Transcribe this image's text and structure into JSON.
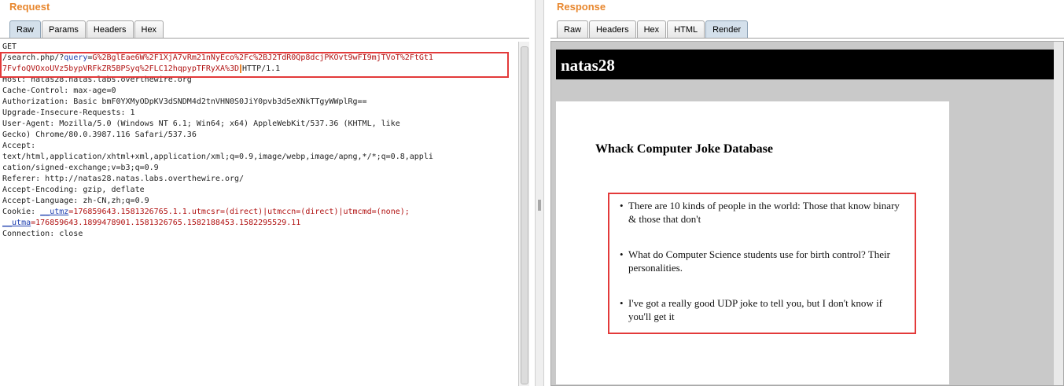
{
  "request": {
    "title": "Request",
    "tabs": [
      "Raw",
      "Params",
      "Headers",
      "Hex"
    ],
    "active_tab": "Raw",
    "lines": {
      "method": "GET",
      "path_prefix": "/search.php/?",
      "query_key": "query",
      "query_eq": "=",
      "query_value_1": "G%2BglEae6W%2F1XjA7vRm21nNyEco%2Fc%2BJ2TdR0Qp8dcjPKOvt9wFI9mjTVoT%2FtGt1",
      "query_value_2": "7FvfoQVOxoUVz5bypVRFkZR5BPSyq%2FLC12hqpypTFRyXA%3D",
      "http_version": "HTTP/1.1",
      "host": "Host: natas28.natas.labs.overthewire.org",
      "cache_control": "Cache-Control: max-age=0",
      "authorization": "Authorization: Basic bmF0YXMyODpKV3dSNDM4d2tnVHN0S0JiY0pvb3d5eXNkTTgyWWplRg==",
      "upgrade": "Upgrade-Insecure-Requests: 1",
      "user_agent_1": "User-Agent: Mozilla/5.0 (Windows NT 6.1; Win64; x64) AppleWebKit/537.36 (KHTML, like",
      "user_agent_2": "Gecko) Chrome/80.0.3987.116 Safari/537.36",
      "accept_label": "Accept:",
      "accept_1": "text/html,application/xhtml+xml,application/xml;q=0.9,image/webp,image/apng,*/*;q=0.8,appli",
      "accept_2": "cation/signed-exchange;v=b3;q=0.9",
      "referer": "Referer: http://natas28.natas.labs.overthewire.org/",
      "accept_encoding": "Accept-Encoding: gzip, deflate",
      "accept_language": "Accept-Language: zh-CN,zh;q=0.9",
      "cookie_label": "Cookie: ",
      "cookie_utmz_key": "__utmz",
      "cookie_utmz_val": "=176859643.1581326765.1.1.utmcsr=(direct)|utmccn=(direct)|utmcmd=(none);",
      "cookie_utma_key": "__utma",
      "cookie_utma_val": "=176859643.1899478901.1581326765.1582188453.1582295529.11",
      "connection": "Connection: close"
    }
  },
  "response": {
    "title": "Response",
    "tabs": [
      "Raw",
      "Headers",
      "Hex",
      "HTML",
      "Render"
    ],
    "active_tab": "Render",
    "site_title": "natas28",
    "page_heading": "Whack Computer Joke Database",
    "jokes": [
      "There are 10 kinds of people in the world: Those that know binary & those that don't",
      "What do Computer Science students use for birth control? Their personalities.",
      "I've got a really good UDP joke to tell you, but I don't know if you'll get it"
    ]
  },
  "colors": {
    "title_orange": "#e8872e",
    "highlight_red": "#e33a3a",
    "param_blue": "#2040b0",
    "value_red": "#b01010"
  }
}
